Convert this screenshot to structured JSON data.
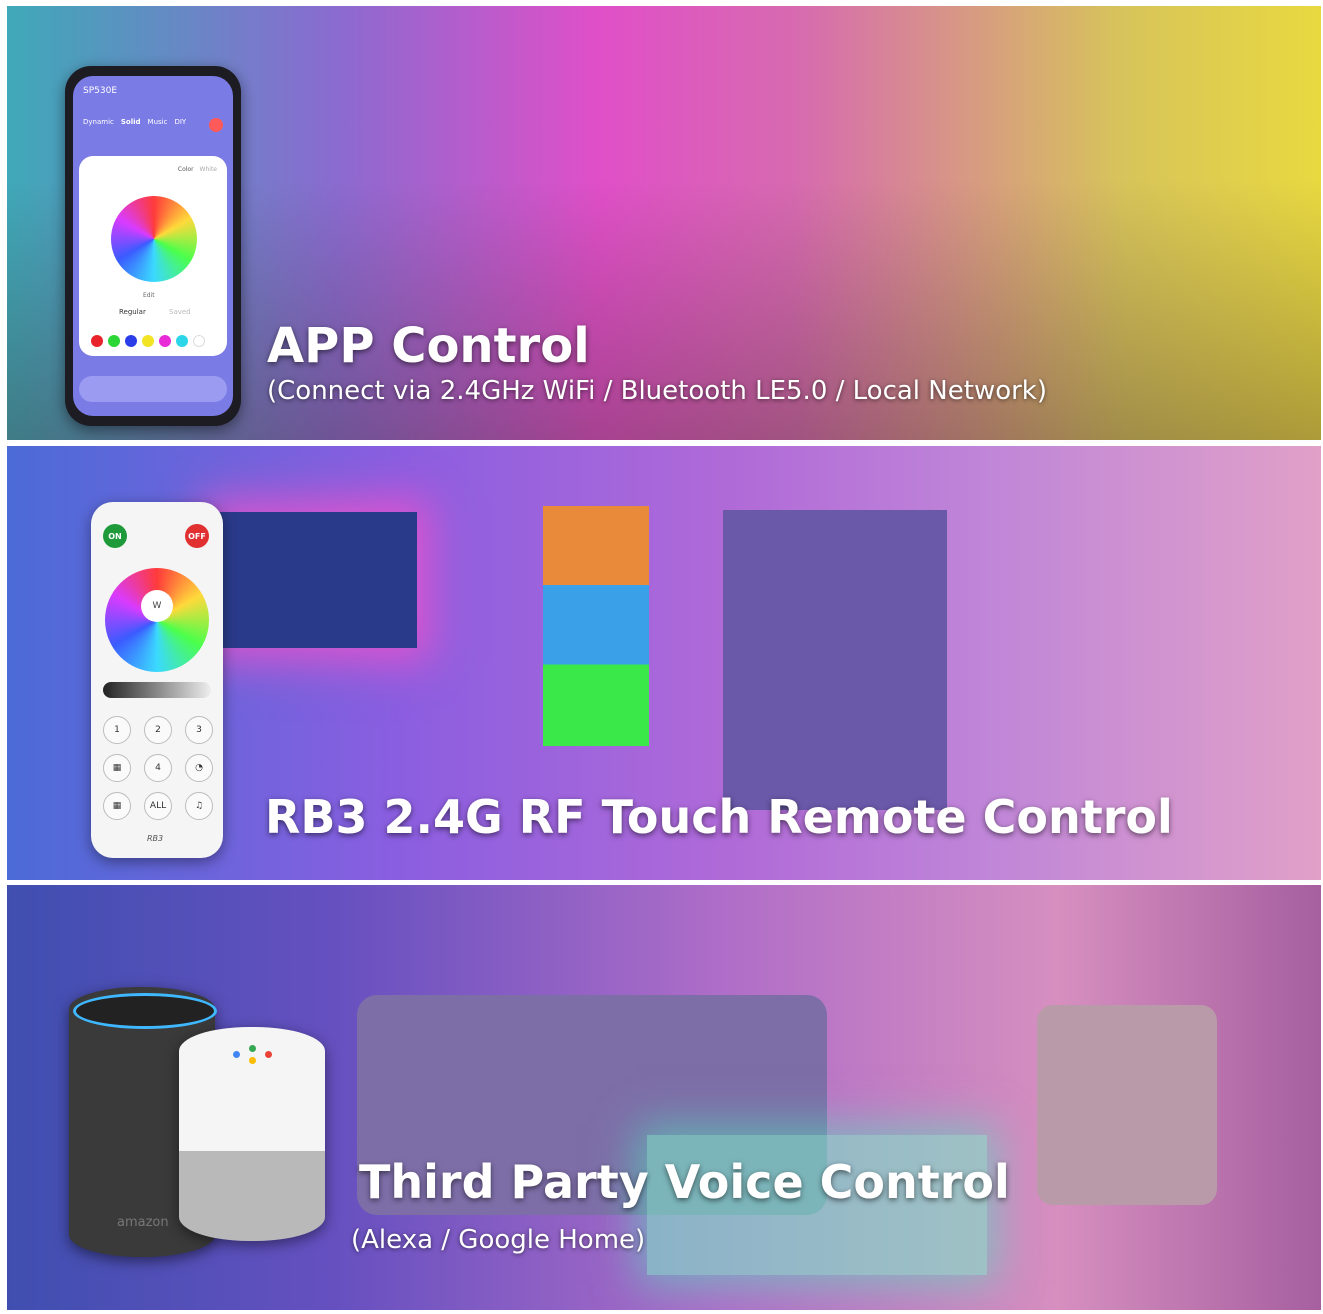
{
  "sections": [
    {
      "title": "APP Control",
      "subtitle": "(Connect via 2.4GHz WiFi / Bluetooth LE5.0 / Local Network)"
    },
    {
      "title": "RB3 2.4G RF Touch Remote Control"
    },
    {
      "title": "Third Party Voice Control",
      "subtitle": "(Alexa / Google Home)"
    }
  ],
  "phone": {
    "device": "SP530E",
    "tabs": [
      "Dynamic",
      "Solid",
      "Music",
      "DIY"
    ],
    "mode_tabs": [
      "Color",
      "White"
    ],
    "edit": "Edit",
    "regular": "Regular",
    "saved": "Saved",
    "swatches": [
      "#e8232b",
      "#2bd636",
      "#2b3de8",
      "#f2e422",
      "#e82bd6",
      "#2bd6e8",
      "#ffffff"
    ]
  },
  "remote": {
    "on": "ON",
    "off": "OFF",
    "white": "W",
    "keys": [
      "1",
      "2",
      "3",
      "4",
      "ALL"
    ],
    "model": "RB3"
  },
  "echo_brand": "amazon"
}
